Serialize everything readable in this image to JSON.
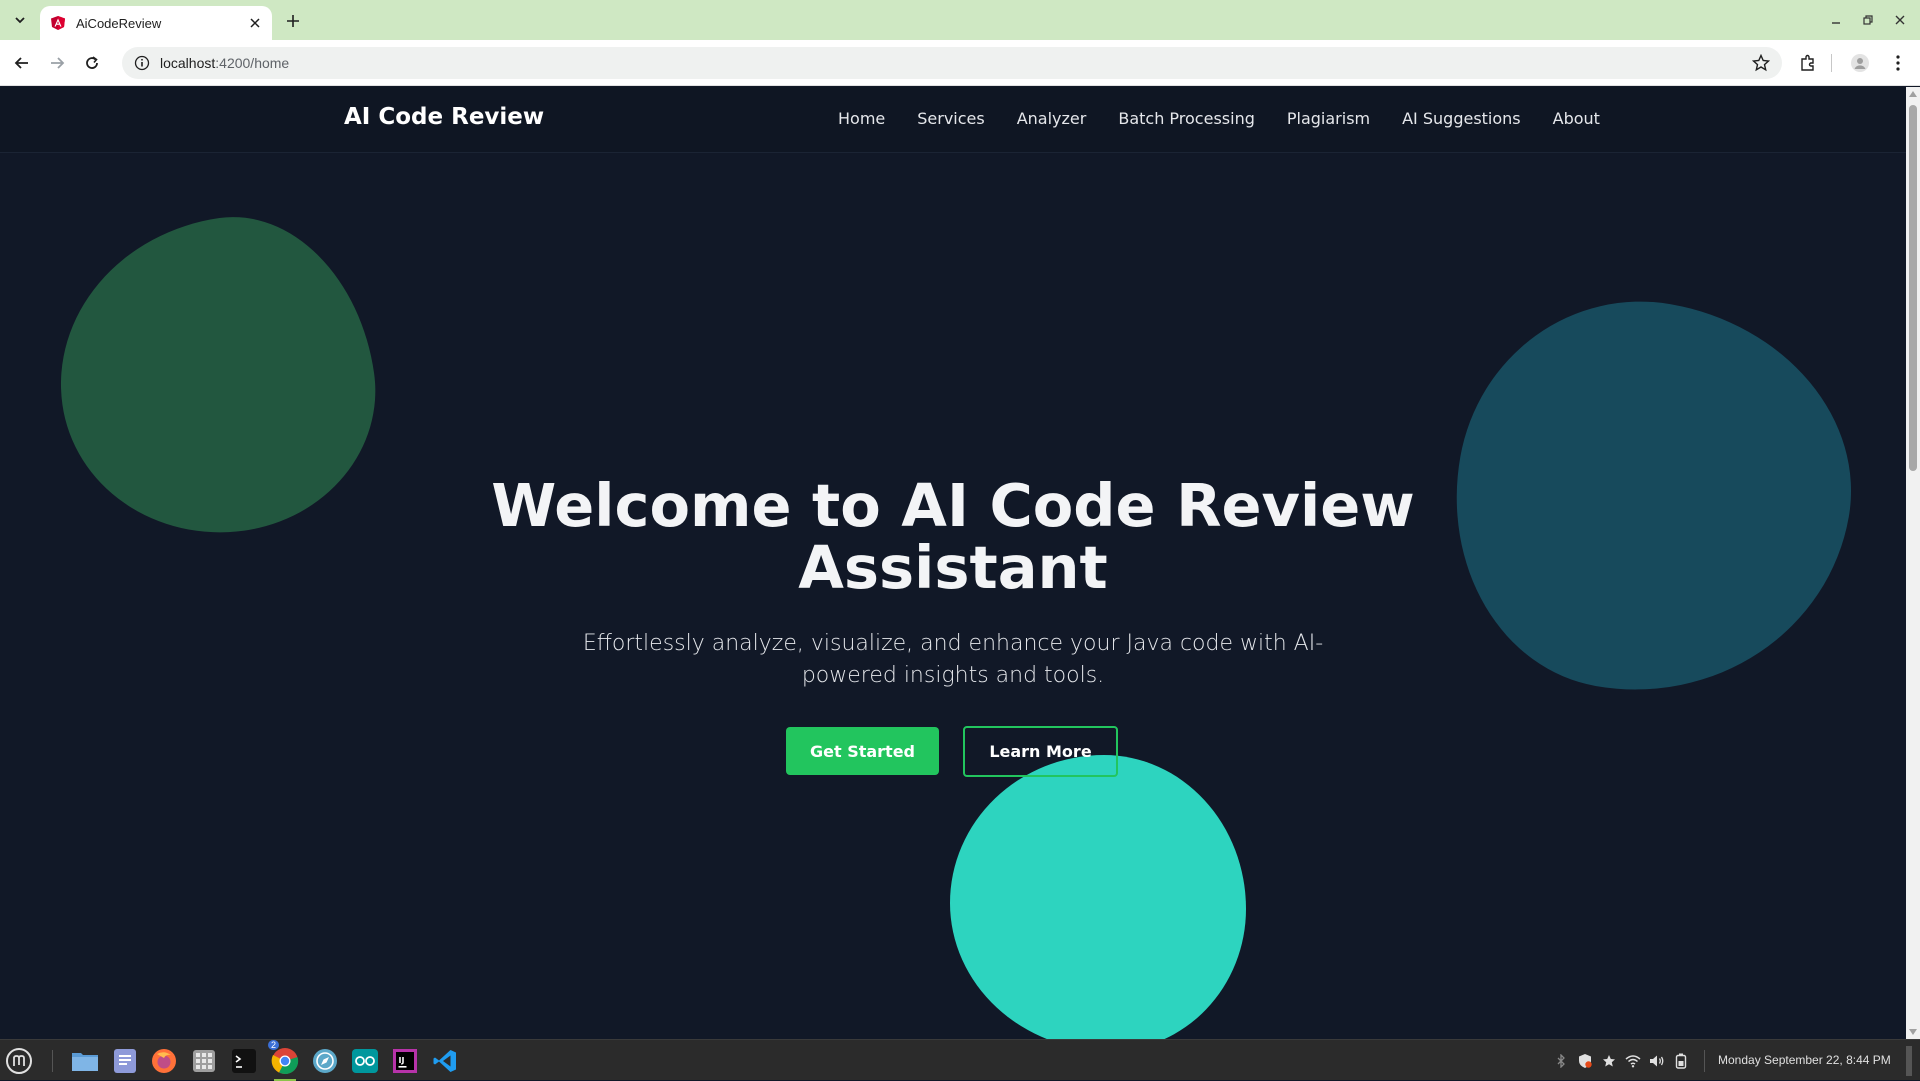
{
  "browser": {
    "tab_title": "AiCodeReview",
    "url_host": "localhost",
    "url_path": ":4200/home"
  },
  "site": {
    "brand": "AI Code Review",
    "nav": [
      "Home",
      "Services",
      "Analyzer",
      "Batch Processing",
      "Plagiarism",
      "AI Suggestions",
      "About"
    ]
  },
  "hero": {
    "title_line1": "Welcome to AI Code Review",
    "title_line2": "Assistant",
    "subtitle_line1": "Effortlessly analyze, visualize, and enhance your Java code with AI-",
    "subtitle_line2": "powered insights and tools.",
    "primary_button": "Get Started",
    "secondary_button": "Learn More"
  },
  "taskbar": {
    "clock": "Monday September 22,  8:44 PM",
    "chrome_badge": "2",
    "apps": [
      "menu-icon",
      "files-icon",
      "text-editor-icon",
      "firefox-icon",
      "app-grid-icon",
      "terminal-icon",
      "chrome-icon",
      "compass-icon",
      "arduino-icon",
      "intellij-icon",
      "vscode-icon"
    ]
  },
  "colors": {
    "page_bg": "#111827",
    "accent_green": "#22c55e",
    "blob_green": "#22573f",
    "blob_blue": "#174a5c",
    "blob_teal": "#2dd4bf"
  }
}
